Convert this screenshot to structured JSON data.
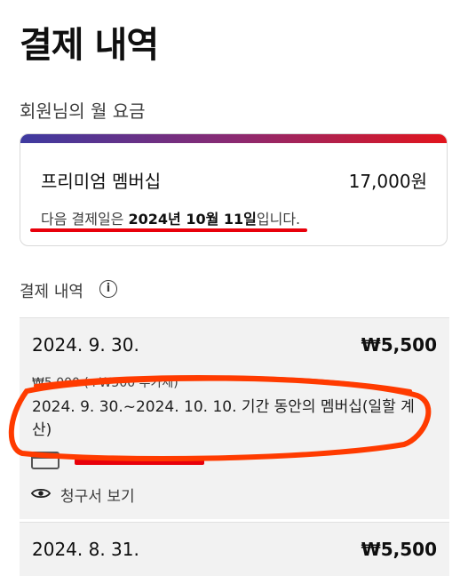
{
  "page": {
    "title": "결제 내역"
  },
  "monthly_fee": {
    "section_label": "회원님의 월 요금",
    "plan_name": "프리미엄 멤버십",
    "price": "17,000원",
    "next_billing_prefix": "다음 결제일은 ",
    "next_billing_date": "2024년 10월 11일",
    "next_billing_suffix": "입니다."
  },
  "history": {
    "section_label": "결제 내역",
    "items": [
      {
        "date": "2024. 9. 30.",
        "amount": "₩5,500",
        "tax_detail": "₩5,000 (+₩500 부가세)",
        "description": "2024. 9. 30.~2024. 10. 10. 기간 동안의 멤버십(일할 계산)",
        "invoice_label": "청구서 보기"
      },
      {
        "date": "2024. 8. 31.",
        "amount": "₩5,500"
      }
    ]
  },
  "colors": {
    "accent_red": "#e8000b",
    "annotation_orange": "#ff3b00",
    "gradient_start": "#3e3aa0",
    "gradient_end": "#e2141c"
  },
  "icons": {
    "info": "info-icon",
    "card": "credit-card-icon",
    "eye": "eye-icon"
  }
}
